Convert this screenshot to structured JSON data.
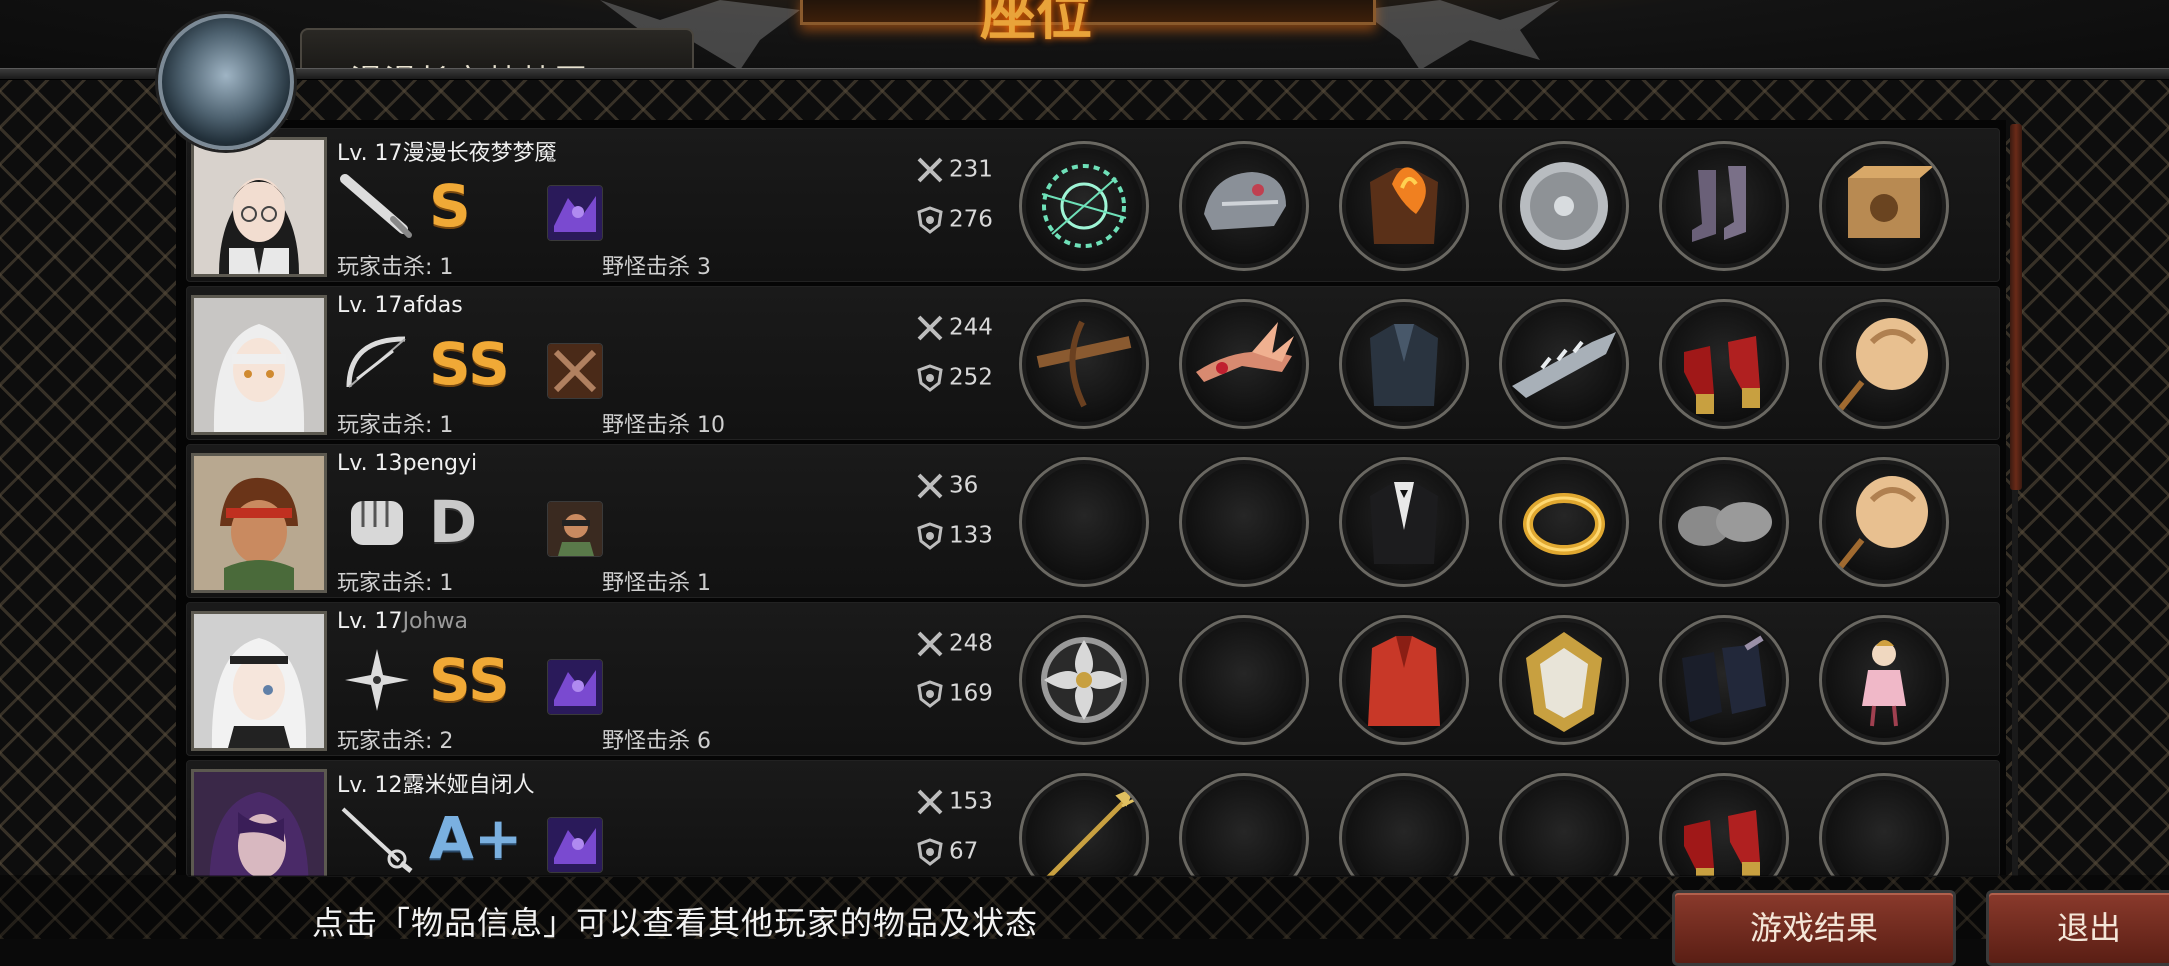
{
  "header": {
    "title": "座位",
    "current_player_name": "漫漫长夜梦梦魇"
  },
  "players": [
    {
      "level": "Lv. 17",
      "name": "漫漫长夜梦梦魇",
      "weapon_icon": "bat-icon",
      "grade": "S",
      "skill_icon": "purple-beast-skill-icon",
      "player_kills": "玩家击杀: 1",
      "monster_kills": "野怪击杀 3",
      "attack": "231",
      "defense": "276",
      "equipment": [
        "green-chain-weapon",
        "steel-helmet",
        "flaming-armor",
        "round-plate",
        "purple-boots",
        "cat-box"
      ]
    },
    {
      "level": "Lv. 17",
      "name": "afdas",
      "weapon_icon": "bow-icon",
      "grade": "SS",
      "skill_icon": "crossed-blades-skill-icon",
      "player_kills": "玩家击杀: 1",
      "monster_kills": "野怪击杀 10",
      "attack": "244",
      "defense": "252",
      "equipment": [
        "crossbow",
        "winged-tiara",
        "dark-jacket",
        "spiked-bracer",
        "red-heels",
        "face-fan"
      ]
    },
    {
      "level": "Lv. 13",
      "name": "pengyi",
      "weapon_icon": "fist-icon",
      "grade": "D",
      "skill_icon": "portrait-skill-icon",
      "player_kills": "玩家击杀: 1",
      "monster_kills": "野怪击杀 1",
      "attack": "36",
      "defense": "133",
      "equipment": [
        "empty",
        "empty",
        "black-suit",
        "gold-bracelet",
        "slippers",
        "face-fan"
      ]
    },
    {
      "level": "Lv. 17",
      "name": "Johwa",
      "weapon_icon": "shuriken-icon",
      "grade": "SS",
      "skill_icon": "purple-beast-skill-icon",
      "player_kills": "玩家击杀: 2",
      "monster_kills": "野怪击杀 6",
      "attack": "248",
      "defense": "169",
      "equipment": [
        "shuriken-star",
        "empty",
        "red-coat",
        "gold-shield",
        "black-boots",
        "doll"
      ]
    },
    {
      "level": "Lv. 12",
      "name": "露米娅自闭人",
      "weapon_icon": "rapier-icon",
      "grade": "A+",
      "skill_icon": "purple-beast-skill-icon",
      "player_kills": "",
      "monster_kills": "",
      "attack": "153",
      "defense": "67",
      "equipment": [
        "golden-spear",
        "empty",
        "empty",
        "empty",
        "red-heels",
        "empty"
      ]
    }
  ],
  "footer": {
    "hint": "点击「物品信息」可以查看其他玩家的物品及状态",
    "result_button": "游戏结果",
    "exit_button": "退出"
  },
  "colors": {
    "grade_gold": "#f0a936",
    "button_red": "#8a3a2c",
    "scroll_thumb": "#6a2a18"
  }
}
